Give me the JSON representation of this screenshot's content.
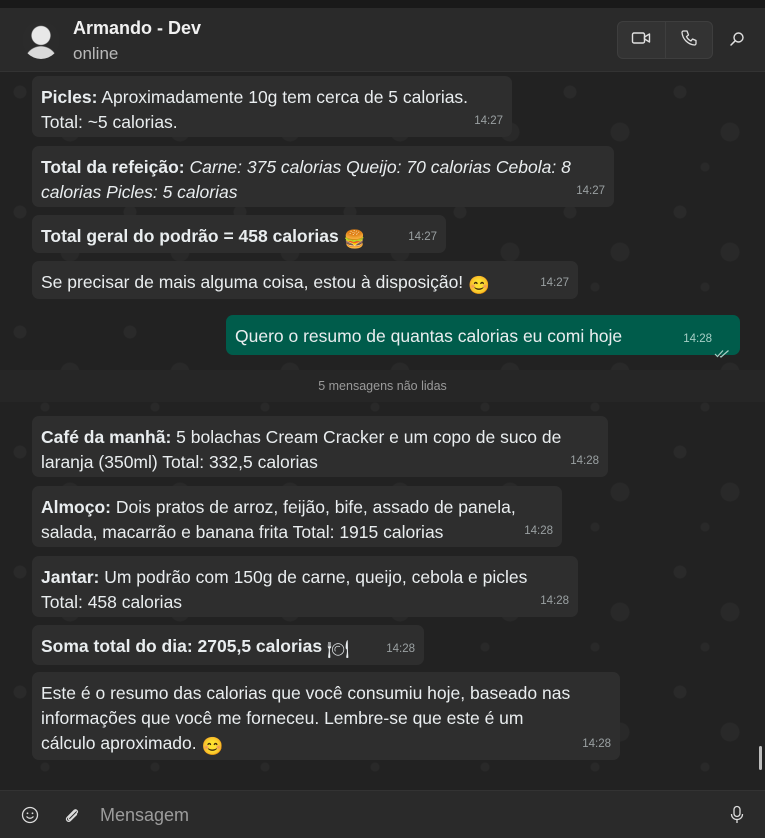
{
  "contact": {
    "name": "Armando - Dev",
    "status": "online"
  },
  "icons": {
    "video": "video-call-icon",
    "phone": "voice-call-icon",
    "search": "search-icon",
    "emoji": "emoji-icon",
    "attach": "attach-icon",
    "mic": "microphone-icon"
  },
  "colors": {
    "incoming_bubble": "#2e2e2e",
    "outgoing_bubble": "#005c4b",
    "background": "#222222"
  },
  "messages": [
    {
      "dir": "in",
      "label": "Picles:",
      "text": " Aproximadamente 10g tem cerca de 5 calorias.",
      "text2": "Total: ~5 calorias.",
      "time": "14:27"
    },
    {
      "dir": "in",
      "label": "Total da refeição:",
      "text": " Carne: 375 calorias Queijo: 70 calorias  Cebola: 8",
      "text2": "calorias Picles: 5 calorias",
      "time": "14:27"
    },
    {
      "dir": "in",
      "label": "Total geral do podrão = 458 calorias",
      "emoji": "🍔",
      "time": "14:27"
    },
    {
      "dir": "in",
      "text": "Se precisar de mais alguma coisa, estou à disposição!",
      "emoji": "😊",
      "time": "14:27"
    },
    {
      "dir": "out",
      "text": "Quero o resumo de quantas calorias eu comi hoje",
      "time": "14:28"
    },
    {
      "dir": "in",
      "label": "Café da manhã:",
      "text": " 5 bolachas Cream Cracker e um copo de suco de",
      "text2": "laranja (350ml) Total: 332,5 calorias",
      "time": "14:28"
    },
    {
      "dir": "in",
      "label": "Almoço:",
      "text": " Dois pratos de arroz, feijão, bife, assado de panela,",
      "text2": "salada, macarrão e banana frita Total: 1915 calorias",
      "time": "14:28"
    },
    {
      "dir": "in",
      "label": "Jantar:",
      "text": " Um podrão com 150g de carne, queijo, cebola e picles",
      "text2": "Total: 458 calorias",
      "time": "14:28"
    },
    {
      "dir": "in",
      "label": "Soma total do dia: 2705,5 calorias",
      "emoji": "🍽",
      "time": "14:28"
    },
    {
      "dir": "in",
      "text": "Este é o resumo das calorias que você consumiu hoje, baseado nas",
      "text2": "informações que você me forneceu. Lembre-se que este é um",
      "text3": "cálculo aproximado.",
      "emoji": "😊",
      "time": "14:28"
    }
  ],
  "unread_divider": "5 mensagens não lidas",
  "composer": {
    "placeholder": "Mensagem"
  }
}
